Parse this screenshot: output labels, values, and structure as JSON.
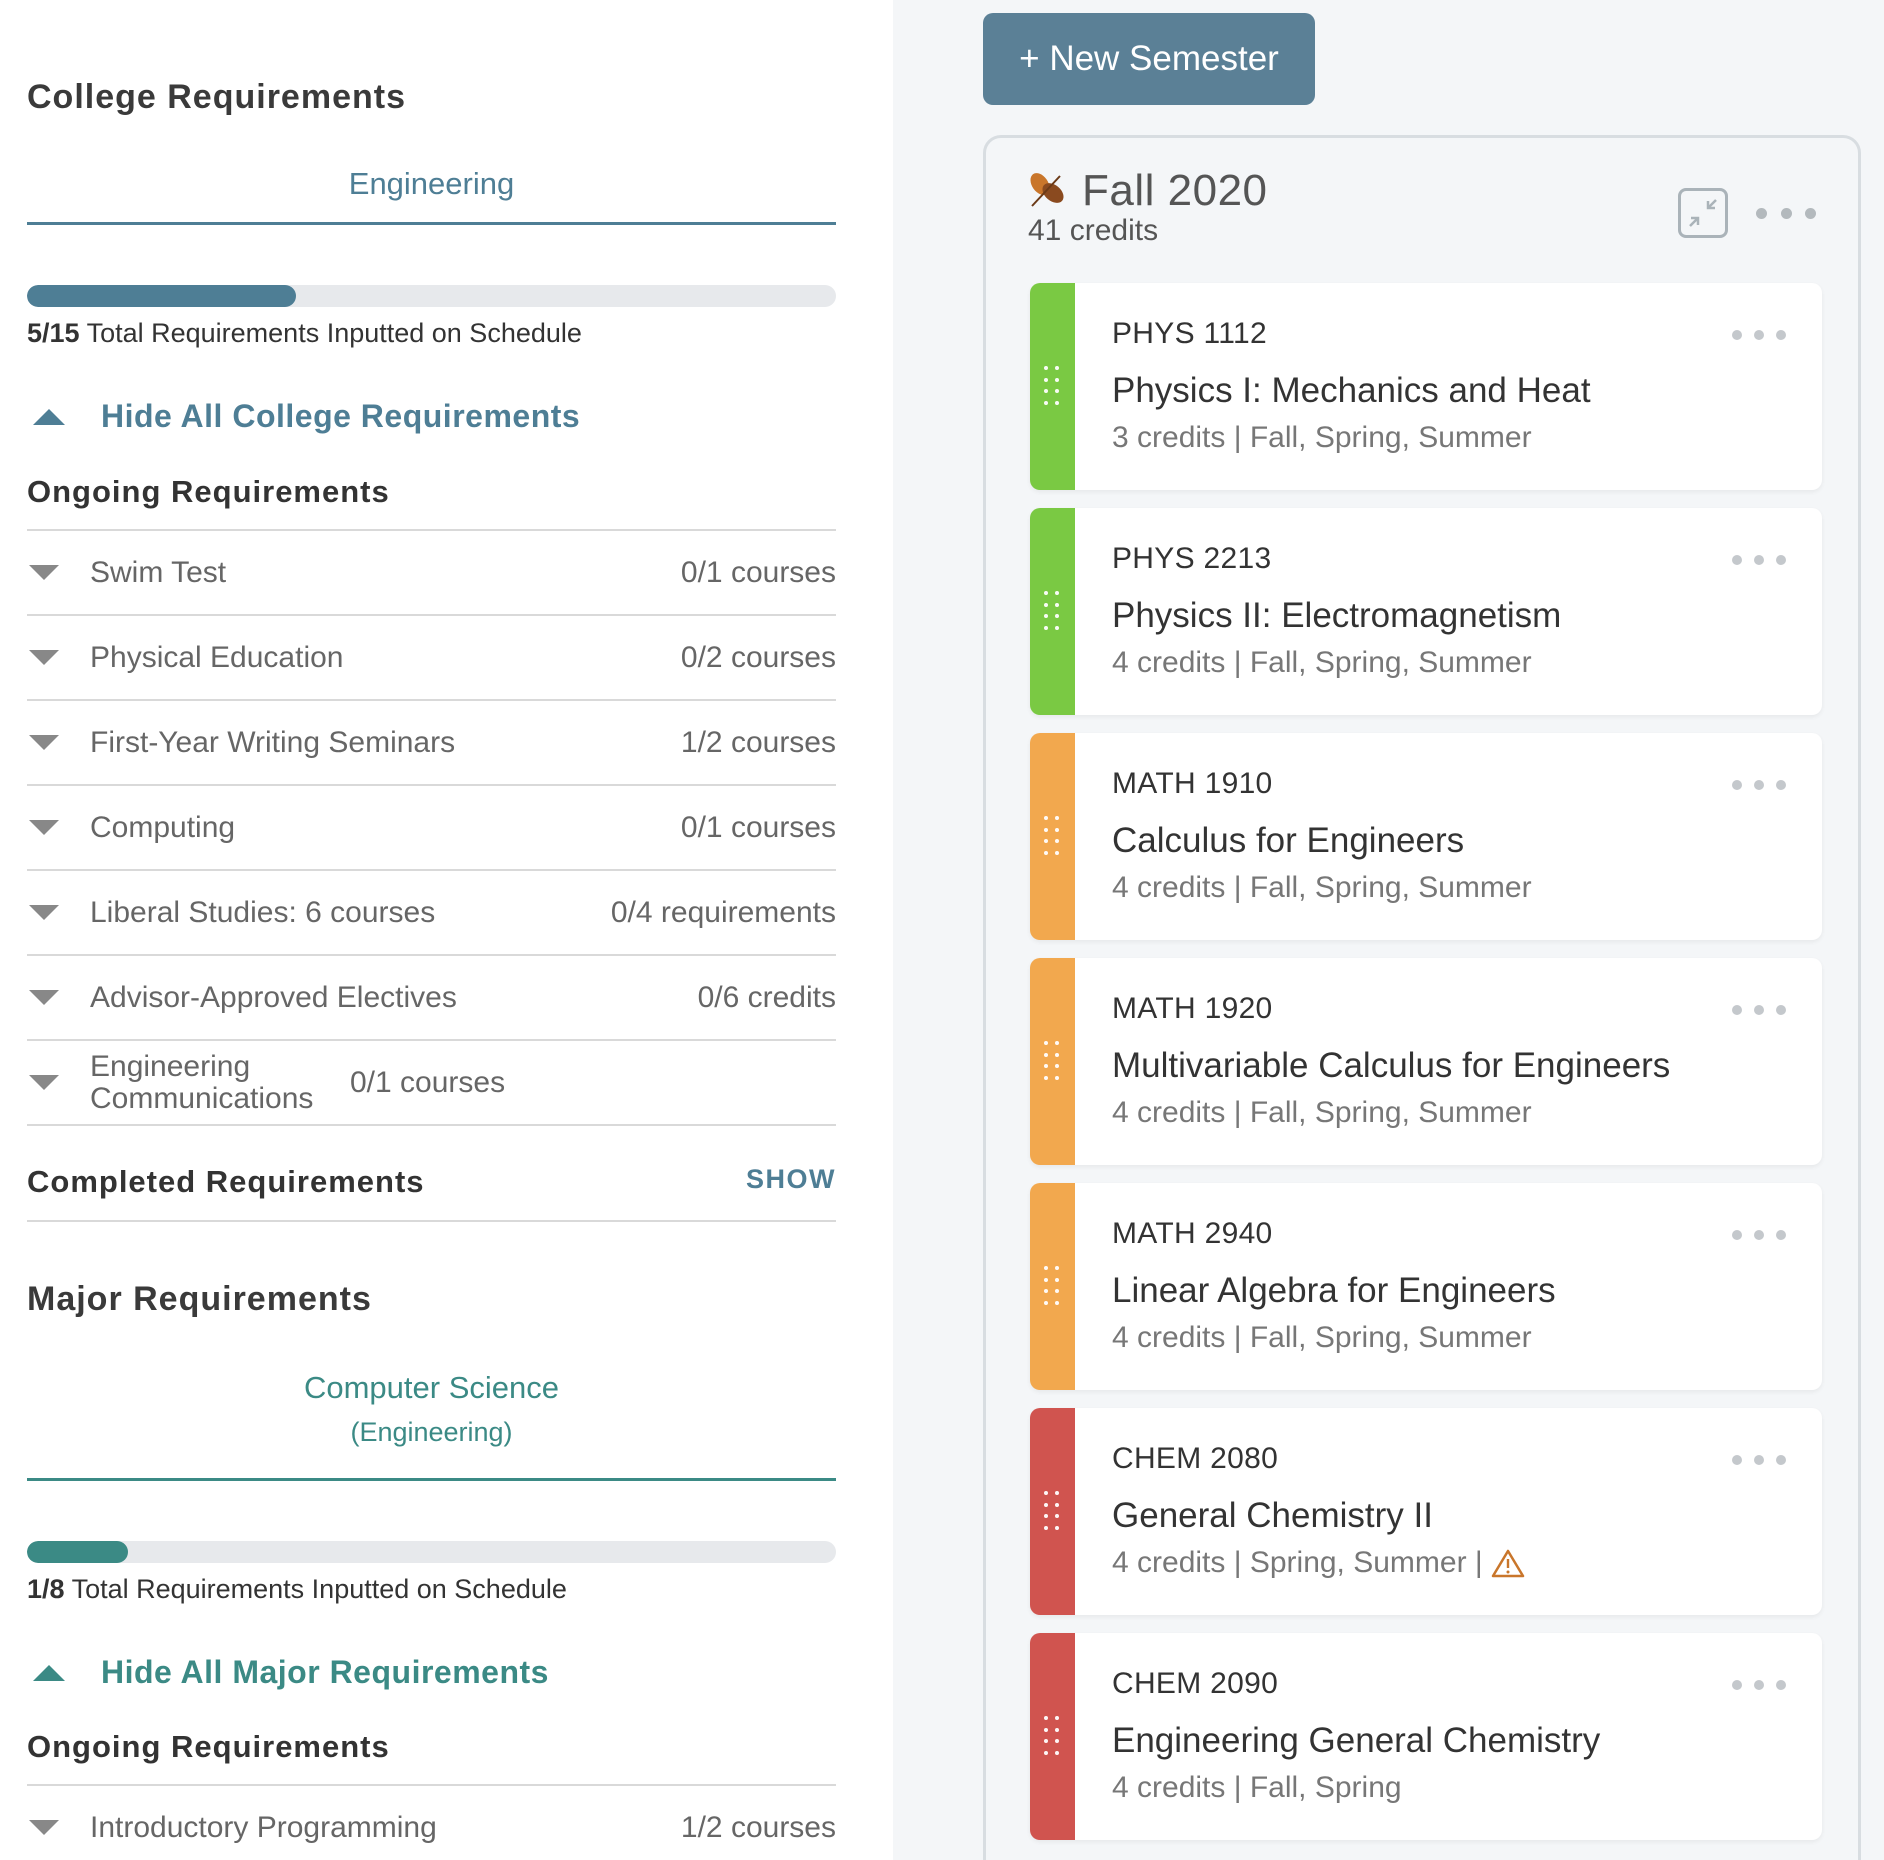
{
  "colors": {
    "college_accent": "#4e7e95",
    "major_accent": "#3b8a85",
    "green": "#7ac943",
    "orange": "#f2a84e",
    "red": "#d0544f",
    "button_bg": "#5b8096"
  },
  "college": {
    "heading": "College Requirements",
    "tab": "Engineering",
    "progress": {
      "done": "5/15",
      "label": "Total Requirements Inputted on Schedule",
      "fraction": 0.333
    },
    "toggle": "Hide All College Requirements",
    "ongoing_heading": "Ongoing Requirements",
    "requirements": [
      {
        "name": "Swim Test",
        "count": "0/1 courses"
      },
      {
        "name": "Physical Education",
        "count": "0/2 courses"
      },
      {
        "name": "First-Year Writing Seminars",
        "count": "1/2 courses"
      },
      {
        "name": "Computing",
        "count": "0/1 courses"
      },
      {
        "name": "Liberal Studies: 6 courses",
        "count": "0/4 requirements"
      },
      {
        "name": "Advisor-Approved Electives",
        "count": "0/6 credits"
      },
      {
        "name": "Engineering Communications",
        "count": "0/1 courses"
      }
    ],
    "completed_heading": "Completed Requirements",
    "show_label": "SHOW"
  },
  "major": {
    "heading": "Major Requirements",
    "tab": "Computer Science",
    "tab_sub": "(Engineering)",
    "progress": {
      "done": "1/8",
      "label": "Total Requirements Inputted on Schedule",
      "fraction": 0.125
    },
    "toggle": "Hide All Major Requirements",
    "ongoing_heading": "Ongoing Requirements",
    "requirements": [
      {
        "name": "Introductory Programming",
        "count": "1/2 courses"
      }
    ]
  },
  "planner": {
    "new_semester_label": "+ New Semester",
    "semester": {
      "title": "Fall 2020",
      "credits": "41 credits",
      "icon": "fall-leaves-icon",
      "courses": [
        {
          "code": "PHYS 1112",
          "name": "Physics I: Mechanics and Heat",
          "meta": "3 credits | Fall, Spring, Summer",
          "color": "#7ac943",
          "warning": false
        },
        {
          "code": "PHYS 2213",
          "name": "Physics II: Electromagnetism",
          "meta": "4 credits | Fall, Spring, Summer",
          "color": "#7ac943",
          "warning": false
        },
        {
          "code": "MATH 1910",
          "name": "Calculus for Engineers",
          "meta": "4 credits | Fall, Spring, Summer",
          "color": "#f2a84e",
          "warning": false
        },
        {
          "code": "MATH 1920",
          "name": "Multivariable Calculus for Engineers",
          "meta": "4 credits | Fall, Spring, Summer",
          "color": "#f2a84e",
          "warning": false
        },
        {
          "code": "MATH 2940",
          "name": "Linear Algebra for Engineers",
          "meta": "4 credits | Fall, Spring, Summer",
          "color": "#f2a84e",
          "warning": false
        },
        {
          "code": "CHEM 2080",
          "name": "General Chemistry II",
          "meta": "4 credits | Spring, Summer |",
          "color": "#d0544f",
          "warning": true
        },
        {
          "code": "CHEM 2090",
          "name": "Engineering General Chemistry",
          "meta": "4 credits | Fall, Spring",
          "color": "#d0544f",
          "warning": false
        }
      ]
    }
  }
}
